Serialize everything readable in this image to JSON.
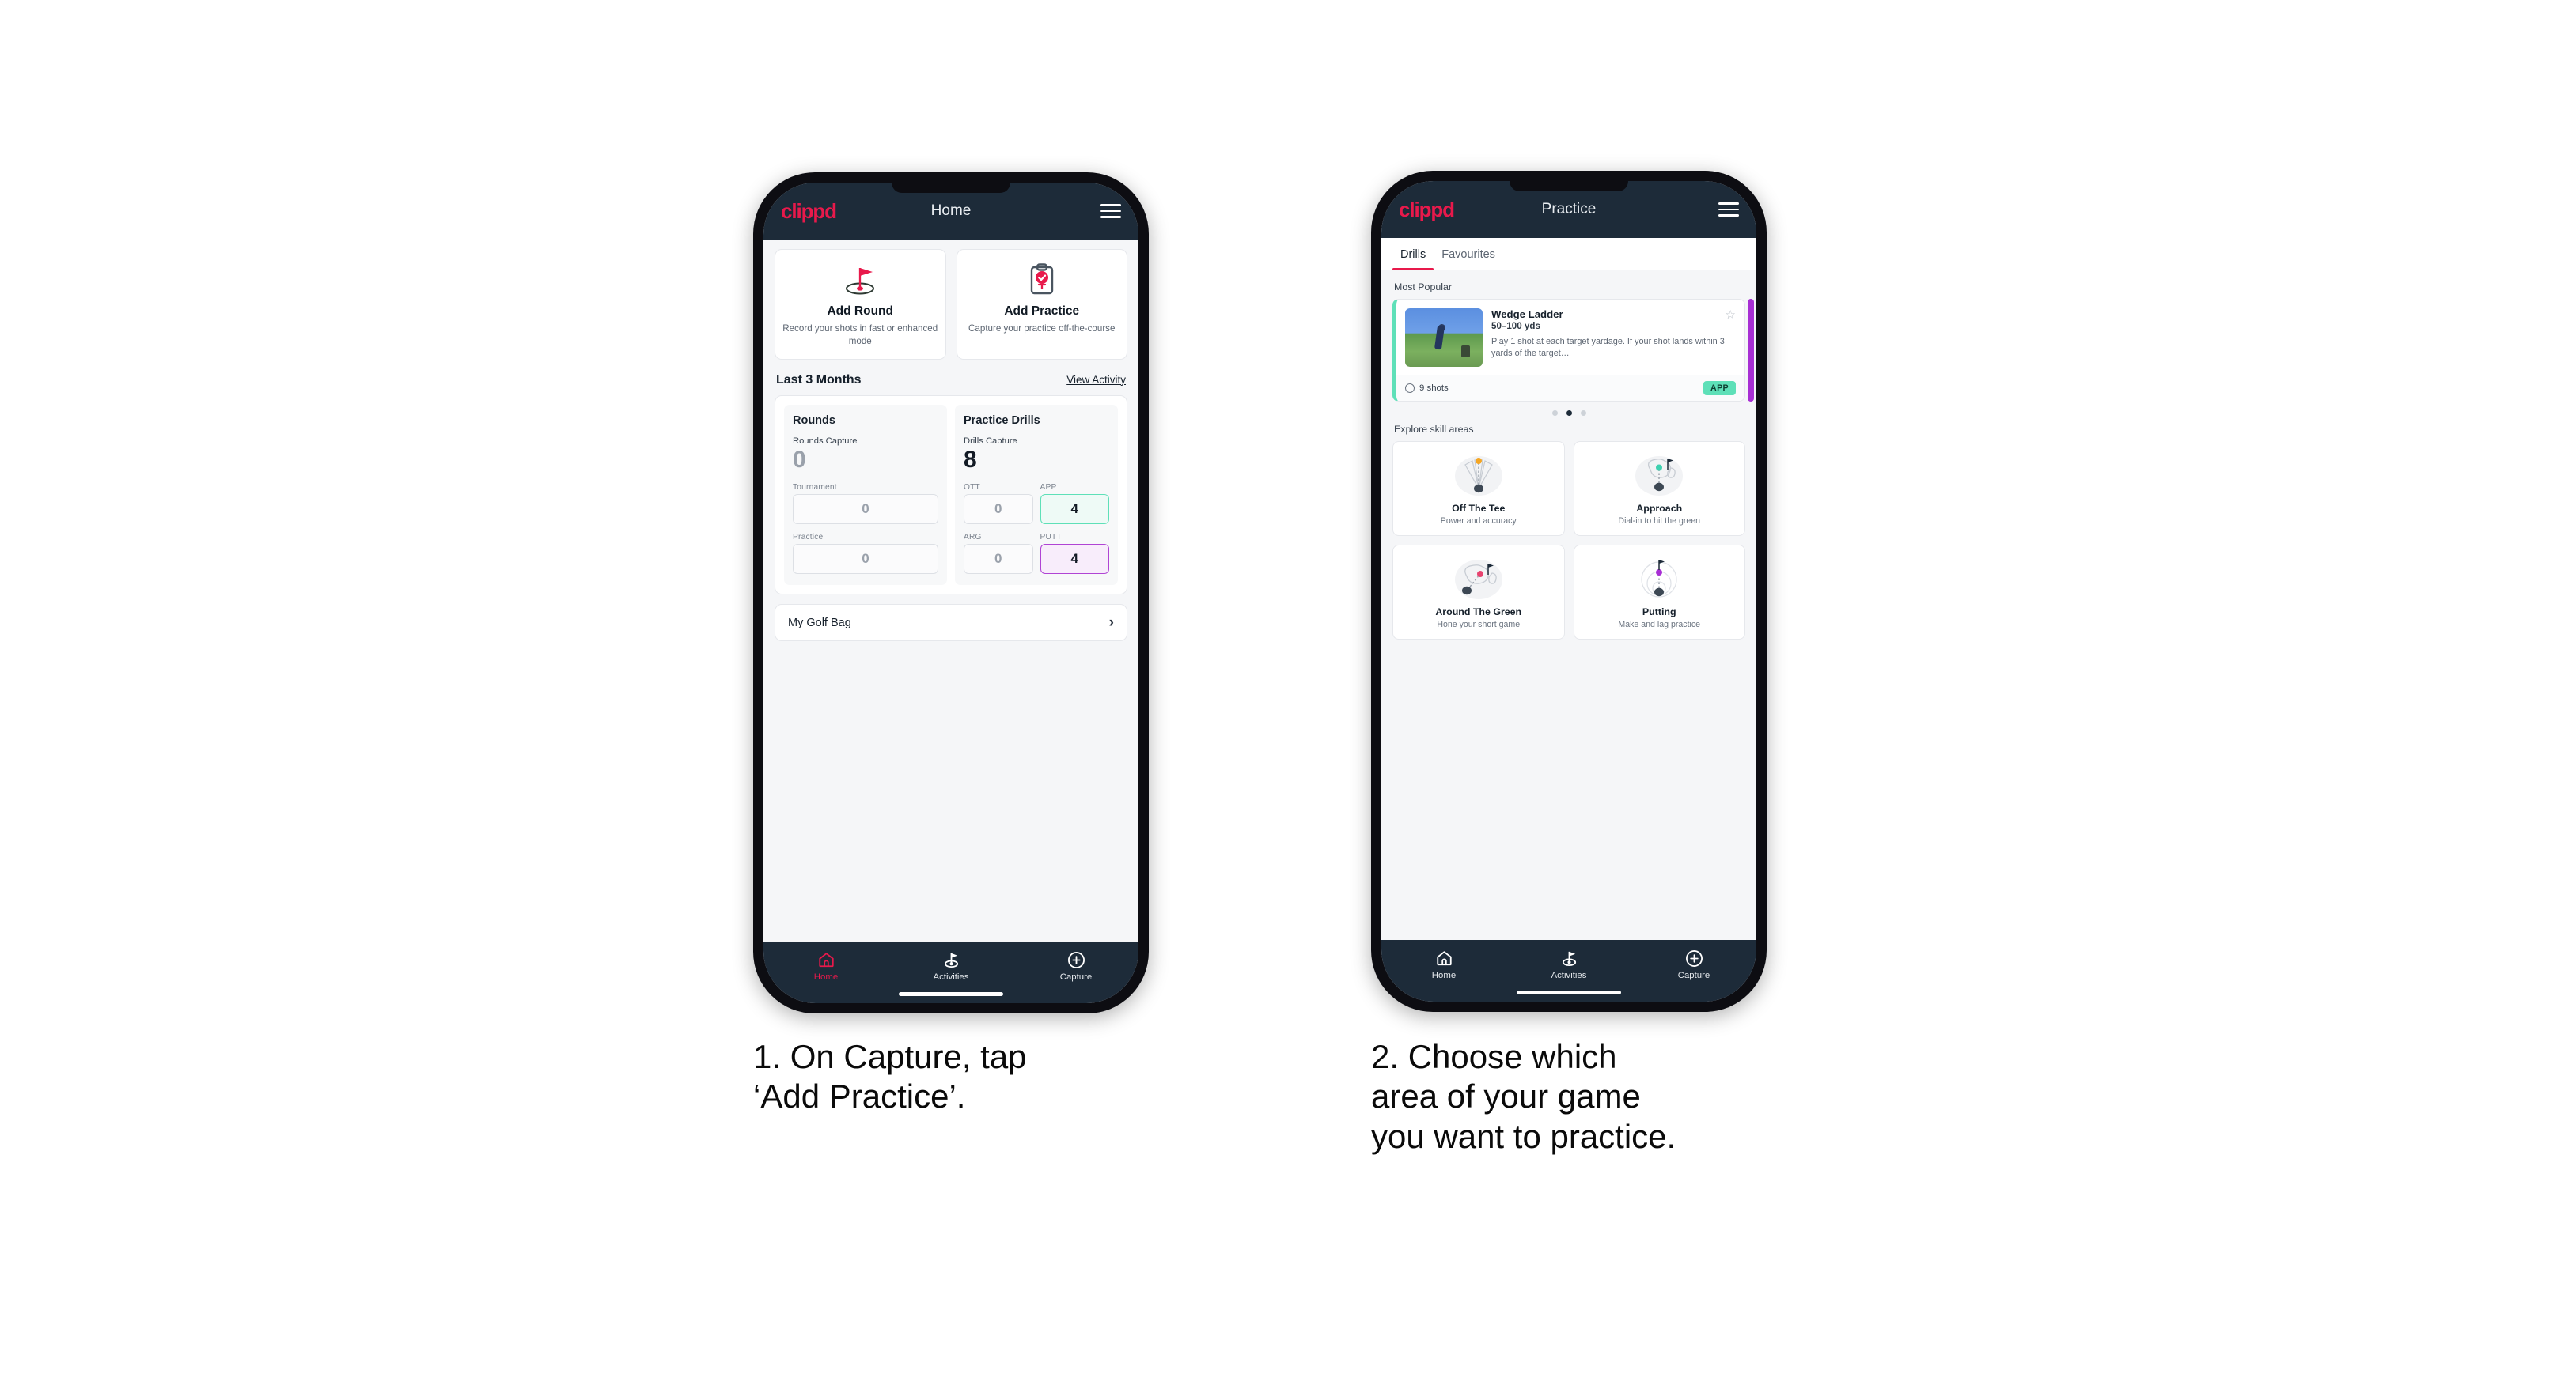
{
  "brand": {
    "logo_text": "clippd",
    "accent": "#e8194b",
    "header_bg": "#1d2b39"
  },
  "phone1": {
    "header": {
      "title": "Home",
      "logo": "clippd",
      "menu_icon": "hamburger-icon"
    },
    "action_cards": [
      {
        "icon": "golf-flag-hole-icon",
        "title": "Add Round",
        "subtitle": "Record your shots in fast or enhanced mode"
      },
      {
        "icon": "clipboard-check-tee-icon",
        "title": "Add Practice",
        "subtitle": "Capture your practice off-the-course"
      }
    ],
    "section": {
      "title": "Last 3 Months",
      "link": "View Activity"
    },
    "stats": {
      "rounds": {
        "heading": "Rounds",
        "capture_label": "Rounds Capture",
        "capture_value": "0",
        "metrics": [
          {
            "label": "Tournament",
            "value": "0",
            "highlight": "none"
          },
          {
            "label": "Practice",
            "value": "0",
            "highlight": "none"
          }
        ]
      },
      "drills": {
        "heading": "Practice Drills",
        "capture_label": "Drills Capture",
        "capture_value": "8",
        "metrics": [
          {
            "label": "OTT",
            "value": "0",
            "highlight": "none"
          },
          {
            "label": "APP",
            "value": "4",
            "highlight": "green"
          },
          {
            "label": "ARG",
            "value": "0",
            "highlight": "none"
          },
          {
            "label": "PUTT",
            "value": "4",
            "highlight": "purple"
          }
        ]
      }
    },
    "golf_bag": {
      "label": "My Golf Bag",
      "chevron": "chevron-right-icon"
    },
    "tabbar": [
      {
        "icon": "home-icon",
        "label": "Home",
        "active": true
      },
      {
        "icon": "golf-flag-icon",
        "label": "Activities",
        "active": false
      },
      {
        "icon": "plus-circle-icon",
        "label": "Capture",
        "active": false
      }
    ]
  },
  "phone2": {
    "header": {
      "title": "Practice",
      "logo": "clippd",
      "menu_icon": "hamburger-icon"
    },
    "tabs": [
      {
        "label": "Drills",
        "selected": true
      },
      {
        "label": "Favourites",
        "selected": false
      }
    ],
    "most_popular_label": "Most Popular",
    "drill": {
      "name": "Wedge Ladder",
      "yardage": "50–100 yds",
      "description": "Play 1 shot at each target yardage. If your shot lands within 3 yards of the target…",
      "shots": "9 shots",
      "badge": "APP",
      "badge_color": "#5ee0b8",
      "star_icon": "star-outline-icon",
      "clock_icon": "clock-icon"
    },
    "carousel_dots": {
      "count": 3,
      "active_index": 1
    },
    "explore_label": "Explore skill areas",
    "skill_areas": [
      {
        "icon": "off-the-tee-dispersion-icon",
        "title": "Off The Tee",
        "subtitle": "Power and accuracy",
        "dot_color": "#f5a623"
      },
      {
        "icon": "approach-green-icon",
        "title": "Approach",
        "subtitle": "Dial-in to hit the green",
        "dot_color": "#3fd1b0"
      },
      {
        "icon": "around-the-green-icon",
        "title": "Around The Green",
        "subtitle": "Hone your short game",
        "dot_color": "#e8436f"
      },
      {
        "icon": "putting-rings-icon",
        "title": "Putting",
        "subtitle": "Make and lag practice",
        "dot_color": "#a82fd4"
      }
    ],
    "tabbar": [
      {
        "icon": "home-icon",
        "label": "Home",
        "active": false
      },
      {
        "icon": "golf-flag-icon",
        "label": "Activities",
        "active": false
      },
      {
        "icon": "plus-circle-icon",
        "label": "Capture",
        "active": false
      }
    ]
  },
  "captions": [
    {
      "text": "1. On Capture, tap\n‘Add Practice’."
    },
    {
      "text": "2. Choose which\narea of your game\nyou want to practice."
    }
  ]
}
